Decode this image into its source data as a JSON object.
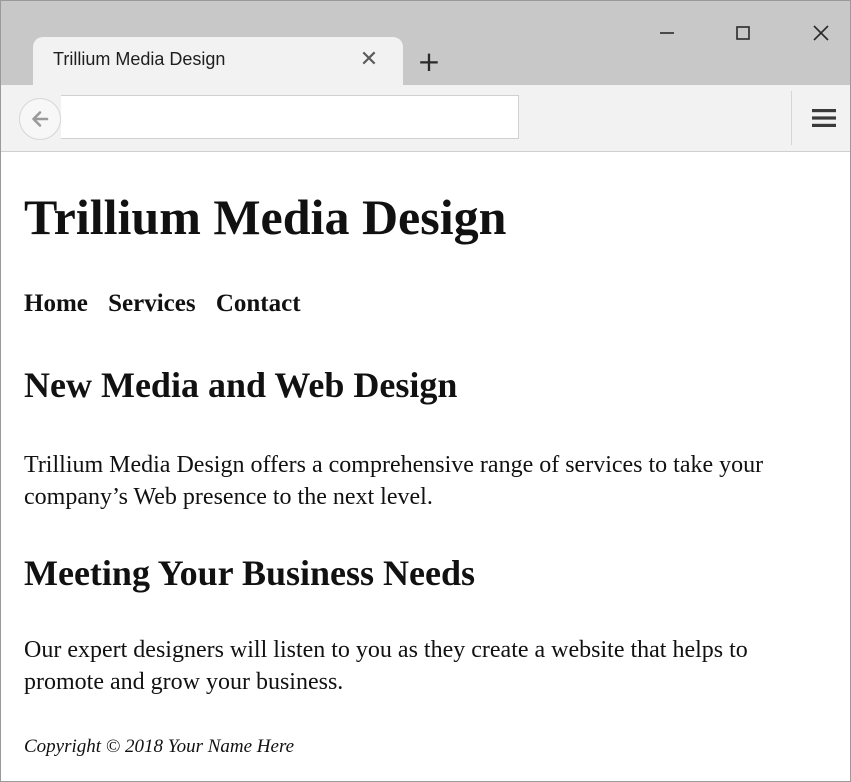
{
  "browser": {
    "tab_title": "Trillium Media Design",
    "tab_close_icon": "close-icon",
    "new_tab_icon": "plus-icon",
    "url": "",
    "window_controls": [
      "minimize-icon",
      "maximize-icon",
      "close-icon"
    ],
    "menu_icon": "hamburger-icon",
    "back_icon": "back-arrow-icon"
  },
  "page": {
    "title": "Trillium Media Design",
    "nav": [
      "Home",
      "Services",
      "Contact"
    ],
    "sections": [
      {
        "heading": "New Media and Web Design",
        "text": "Trillium Media Design offers a comprehensive range of services to take your company’s Web presence to the next level."
      },
      {
        "heading": "Meeting Your Business Needs",
        "text": "Our expert designers will listen to you as they create a website that helps to promote and grow your business."
      }
    ],
    "footer": "Copyright © 2018 Your Name Here"
  },
  "colors": {
    "titlebar": "#c8c8c8",
    "tab": "#f2f2f2",
    "text": "#111111"
  }
}
